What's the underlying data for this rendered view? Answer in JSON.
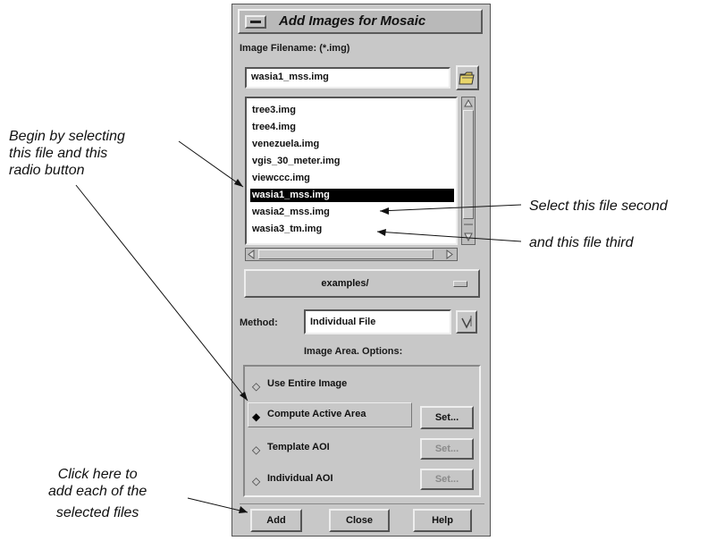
{
  "dialog": {
    "title": "Add Images for Mosaic",
    "filename_label": "Image Filename: (*.img)",
    "filename_value": "wasia1_mss.img",
    "files": [
      "tree3.img",
      "tree4.img",
      "venezuela.img",
      "vgis_30_meter.img",
      "viewccc.img",
      "wasia1_mss.img",
      "wasia2_mss.img",
      "wasia3_tm.img"
    ],
    "selected_file": "wasia1_mss.img",
    "directory": "examples/",
    "method_label": "Method:",
    "method_value": "Individual File",
    "area_options_label": "Image Area. Options:",
    "options": [
      {
        "label": "Use Entire Image",
        "selected": false,
        "set": null
      },
      {
        "label": "Compute Active Area",
        "selected": true,
        "set": "Set...",
        "set_enabled": true
      },
      {
        "label": "Template AOI",
        "selected": false,
        "set": "Set...",
        "set_enabled": false
      },
      {
        "label": "Individual AOI",
        "selected": false,
        "set": "Set...",
        "set_enabled": false
      }
    ],
    "buttons": {
      "add": "Add",
      "close": "Close",
      "help": "Help"
    }
  },
  "annotations": {
    "begin": [
      "Begin by selecting",
      "this file and this",
      "radio button"
    ],
    "second": "Select this file second",
    "third": "and this file third",
    "click_add": [
      "Click here to",
      "add each of the",
      "selected files"
    ]
  }
}
